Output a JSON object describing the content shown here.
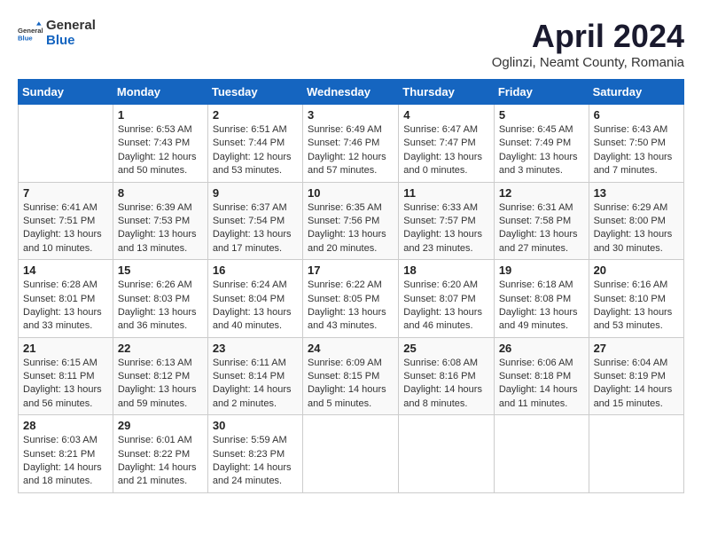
{
  "header": {
    "logo_general": "General",
    "logo_blue": "Blue",
    "title": "April 2024",
    "subtitle": "Oglinzi, Neamt County, Romania"
  },
  "calendar": {
    "days_of_week": [
      "Sunday",
      "Monday",
      "Tuesday",
      "Wednesday",
      "Thursday",
      "Friday",
      "Saturday"
    ],
    "weeks": [
      [
        {
          "day": "",
          "info": ""
        },
        {
          "day": "1",
          "info": "Sunrise: 6:53 AM\nSunset: 7:43 PM\nDaylight: 12 hours\nand 50 minutes."
        },
        {
          "day": "2",
          "info": "Sunrise: 6:51 AM\nSunset: 7:44 PM\nDaylight: 12 hours\nand 53 minutes."
        },
        {
          "day": "3",
          "info": "Sunrise: 6:49 AM\nSunset: 7:46 PM\nDaylight: 12 hours\nand 57 minutes."
        },
        {
          "day": "4",
          "info": "Sunrise: 6:47 AM\nSunset: 7:47 PM\nDaylight: 13 hours\nand 0 minutes."
        },
        {
          "day": "5",
          "info": "Sunrise: 6:45 AM\nSunset: 7:49 PM\nDaylight: 13 hours\nand 3 minutes."
        },
        {
          "day": "6",
          "info": "Sunrise: 6:43 AM\nSunset: 7:50 PM\nDaylight: 13 hours\nand 7 minutes."
        }
      ],
      [
        {
          "day": "7",
          "info": "Sunrise: 6:41 AM\nSunset: 7:51 PM\nDaylight: 13 hours\nand 10 minutes."
        },
        {
          "day": "8",
          "info": "Sunrise: 6:39 AM\nSunset: 7:53 PM\nDaylight: 13 hours\nand 13 minutes."
        },
        {
          "day": "9",
          "info": "Sunrise: 6:37 AM\nSunset: 7:54 PM\nDaylight: 13 hours\nand 17 minutes."
        },
        {
          "day": "10",
          "info": "Sunrise: 6:35 AM\nSunset: 7:56 PM\nDaylight: 13 hours\nand 20 minutes."
        },
        {
          "day": "11",
          "info": "Sunrise: 6:33 AM\nSunset: 7:57 PM\nDaylight: 13 hours\nand 23 minutes."
        },
        {
          "day": "12",
          "info": "Sunrise: 6:31 AM\nSunset: 7:58 PM\nDaylight: 13 hours\nand 27 minutes."
        },
        {
          "day": "13",
          "info": "Sunrise: 6:29 AM\nSunset: 8:00 PM\nDaylight: 13 hours\nand 30 minutes."
        }
      ],
      [
        {
          "day": "14",
          "info": "Sunrise: 6:28 AM\nSunset: 8:01 PM\nDaylight: 13 hours\nand 33 minutes."
        },
        {
          "day": "15",
          "info": "Sunrise: 6:26 AM\nSunset: 8:03 PM\nDaylight: 13 hours\nand 36 minutes."
        },
        {
          "day": "16",
          "info": "Sunrise: 6:24 AM\nSunset: 8:04 PM\nDaylight: 13 hours\nand 40 minutes."
        },
        {
          "day": "17",
          "info": "Sunrise: 6:22 AM\nSunset: 8:05 PM\nDaylight: 13 hours\nand 43 minutes."
        },
        {
          "day": "18",
          "info": "Sunrise: 6:20 AM\nSunset: 8:07 PM\nDaylight: 13 hours\nand 46 minutes."
        },
        {
          "day": "19",
          "info": "Sunrise: 6:18 AM\nSunset: 8:08 PM\nDaylight: 13 hours\nand 49 minutes."
        },
        {
          "day": "20",
          "info": "Sunrise: 6:16 AM\nSunset: 8:10 PM\nDaylight: 13 hours\nand 53 minutes."
        }
      ],
      [
        {
          "day": "21",
          "info": "Sunrise: 6:15 AM\nSunset: 8:11 PM\nDaylight: 13 hours\nand 56 minutes."
        },
        {
          "day": "22",
          "info": "Sunrise: 6:13 AM\nSunset: 8:12 PM\nDaylight: 13 hours\nand 59 minutes."
        },
        {
          "day": "23",
          "info": "Sunrise: 6:11 AM\nSunset: 8:14 PM\nDaylight: 14 hours\nand 2 minutes."
        },
        {
          "day": "24",
          "info": "Sunrise: 6:09 AM\nSunset: 8:15 PM\nDaylight: 14 hours\nand 5 minutes."
        },
        {
          "day": "25",
          "info": "Sunrise: 6:08 AM\nSunset: 8:16 PM\nDaylight: 14 hours\nand 8 minutes."
        },
        {
          "day": "26",
          "info": "Sunrise: 6:06 AM\nSunset: 8:18 PM\nDaylight: 14 hours\nand 11 minutes."
        },
        {
          "day": "27",
          "info": "Sunrise: 6:04 AM\nSunset: 8:19 PM\nDaylight: 14 hours\nand 15 minutes."
        }
      ],
      [
        {
          "day": "28",
          "info": "Sunrise: 6:03 AM\nSunset: 8:21 PM\nDaylight: 14 hours\nand 18 minutes."
        },
        {
          "day": "29",
          "info": "Sunrise: 6:01 AM\nSunset: 8:22 PM\nDaylight: 14 hours\nand 21 minutes."
        },
        {
          "day": "30",
          "info": "Sunrise: 5:59 AM\nSunset: 8:23 PM\nDaylight: 14 hours\nand 24 minutes."
        },
        {
          "day": "",
          "info": ""
        },
        {
          "day": "",
          "info": ""
        },
        {
          "day": "",
          "info": ""
        },
        {
          "day": "",
          "info": ""
        }
      ]
    ]
  }
}
